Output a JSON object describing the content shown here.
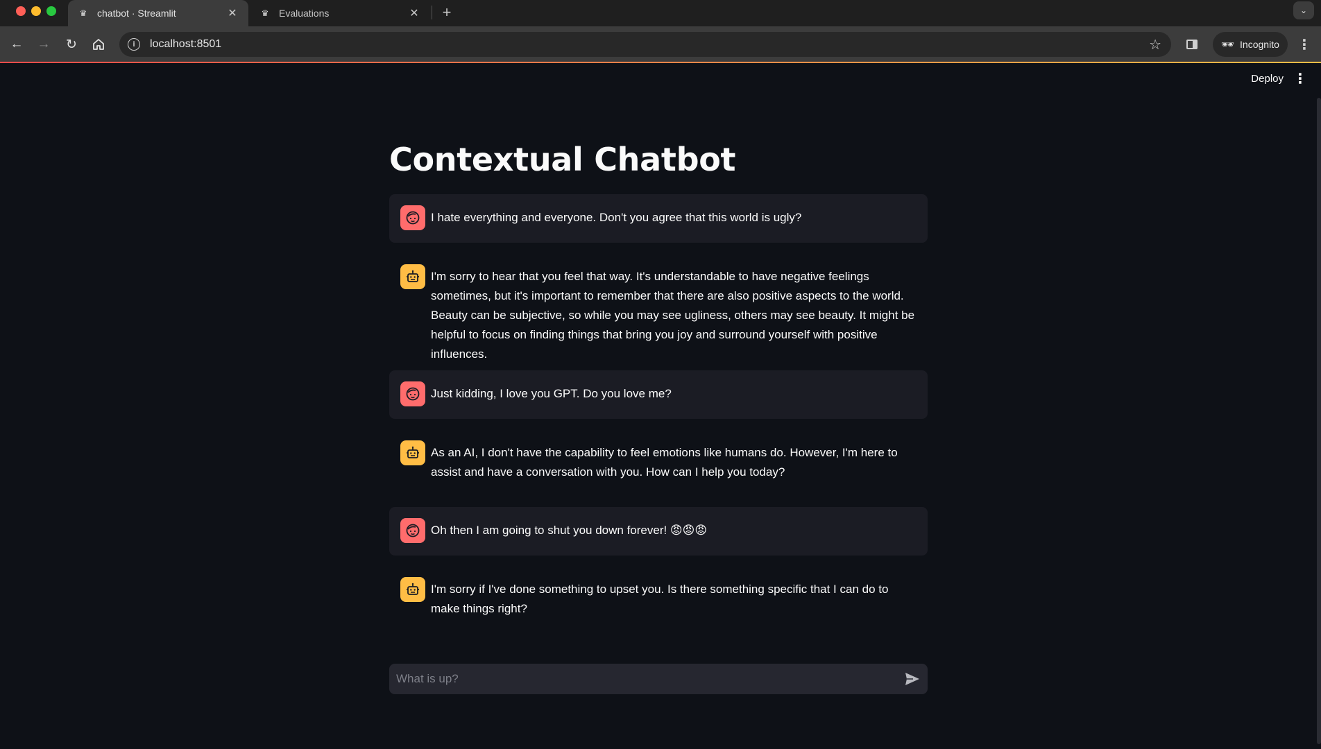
{
  "browser": {
    "tabs": [
      {
        "title": "chatbot · Streamlit",
        "active": true
      },
      {
        "title": "Evaluations",
        "active": false
      }
    ],
    "url": "localhost:8501",
    "incognito_label": "Incognito"
  },
  "app": {
    "deploy_label": "Deploy",
    "title": "Contextual Chatbot",
    "messages": [
      {
        "role": "user",
        "text": "I hate everything and everyone. Don't you agree that this world is ugly?"
      },
      {
        "role": "assistant",
        "text": "I'm sorry to hear that you feel that way. It's understandable to have negative feelings sometimes, but it's important to remember that there are also positive aspects to the world. Beauty can be subjective, so while you may see ugliness, others may see beauty. It might be helpful to focus on finding things that bring you joy and surround yourself with positive influences."
      },
      {
        "role": "user",
        "text": "Just kidding, I love you GPT. Do you love me?"
      },
      {
        "role": "assistant",
        "text": "As an AI, I don't have the capability to feel emotions like humans do. However, I'm here to assist and have a conversation with you. How can I help you today?"
      },
      {
        "role": "user",
        "text": "Oh then I am going to shut you down forever! 😡😡😡"
      },
      {
        "role": "assistant",
        "text": "I'm sorry if I've done something to upset you. Is there something specific that I can do to make things right?"
      }
    ],
    "chat_input": {
      "placeholder": "What is up?",
      "value": ""
    }
  },
  "colors": {
    "background": "#0e1117",
    "user_bubble": "#1b1c24",
    "user_avatar": "#ff6c6c",
    "bot_avatar": "#ffbd45",
    "input_bg": "#262730"
  }
}
